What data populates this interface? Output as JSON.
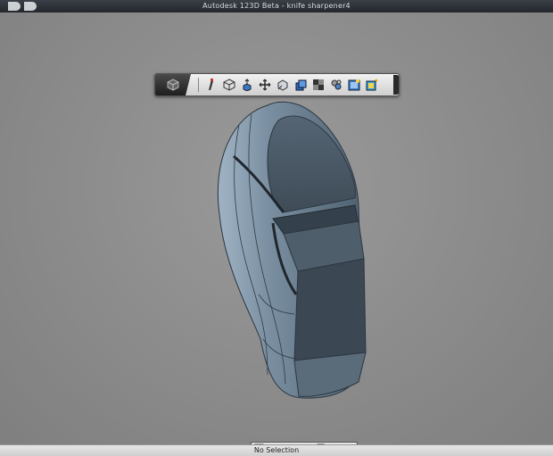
{
  "window": {
    "title": "Autodesk 123D Beta - knife sharpener4"
  },
  "toolbar": {
    "tools": [
      {
        "name": "sketch-pencil-icon"
      },
      {
        "name": "primitives-box-icon"
      },
      {
        "name": "construct-extrude-icon"
      },
      {
        "name": "modify-move-icon"
      },
      {
        "name": "pattern-icon"
      },
      {
        "name": "group-icon"
      },
      {
        "name": "combine-icon"
      },
      {
        "name": "measure-icon"
      },
      {
        "name": "material-icon"
      },
      {
        "name": "snap-icon"
      }
    ]
  },
  "navbar": {
    "tools": [
      {
        "name": "home-view-icon"
      },
      {
        "name": "pan-hand-icon"
      },
      {
        "name": "orbit-icon"
      },
      {
        "name": "zoom-icon"
      },
      {
        "name": "fit-icon"
      },
      {
        "name": "visual-style-icon"
      }
    ]
  },
  "status": {
    "text": "No Selection"
  },
  "colors": {
    "canvas": "#8a8a8a",
    "model": "#6f8294",
    "titlebar": "#2b2f35"
  }
}
